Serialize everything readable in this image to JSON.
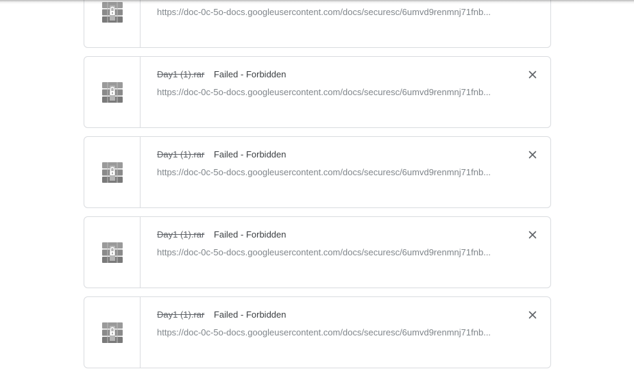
{
  "downloads": [
    {
      "filename": "",
      "status": "",
      "url": "https://doc-0c-5o-docs.googleusercontent.com/docs/securesc/6umvd9renmnj71fnb...",
      "icon": "rar-archive-icon",
      "show_title": false,
      "show_close": false
    },
    {
      "filename": "Day1 (1).rar",
      "status": "Failed - Forbidden",
      "url": "https://doc-0c-5o-docs.googleusercontent.com/docs/securesc/6umvd9renmnj71fnb...",
      "icon": "rar-archive-icon",
      "show_title": true,
      "show_close": true
    },
    {
      "filename": "Day1 (1).rar",
      "status": "Failed - Forbidden",
      "url": "https://doc-0c-5o-docs.googleusercontent.com/docs/securesc/6umvd9renmnj71fnb...",
      "icon": "rar-archive-icon",
      "show_title": true,
      "show_close": true
    },
    {
      "filename": "Day1 (1).rar",
      "status": "Failed - Forbidden",
      "url": "https://doc-0c-5o-docs.googleusercontent.com/docs/securesc/6umvd9renmnj71fnb...",
      "icon": "rar-archive-icon",
      "show_title": true,
      "show_close": true
    },
    {
      "filename": "Day1 (1).rar",
      "status": "Failed - Forbidden",
      "url": "https://doc-0c-5o-docs.googleusercontent.com/docs/securesc/6umvd9renmnj71fnb...",
      "icon": "rar-archive-icon",
      "show_title": true,
      "show_close": true
    }
  ],
  "colors": {
    "border": "#dadce0",
    "status_text": "#3c4043",
    "url_text": "#80868b",
    "icon_gray": "#8a8a8a"
  }
}
